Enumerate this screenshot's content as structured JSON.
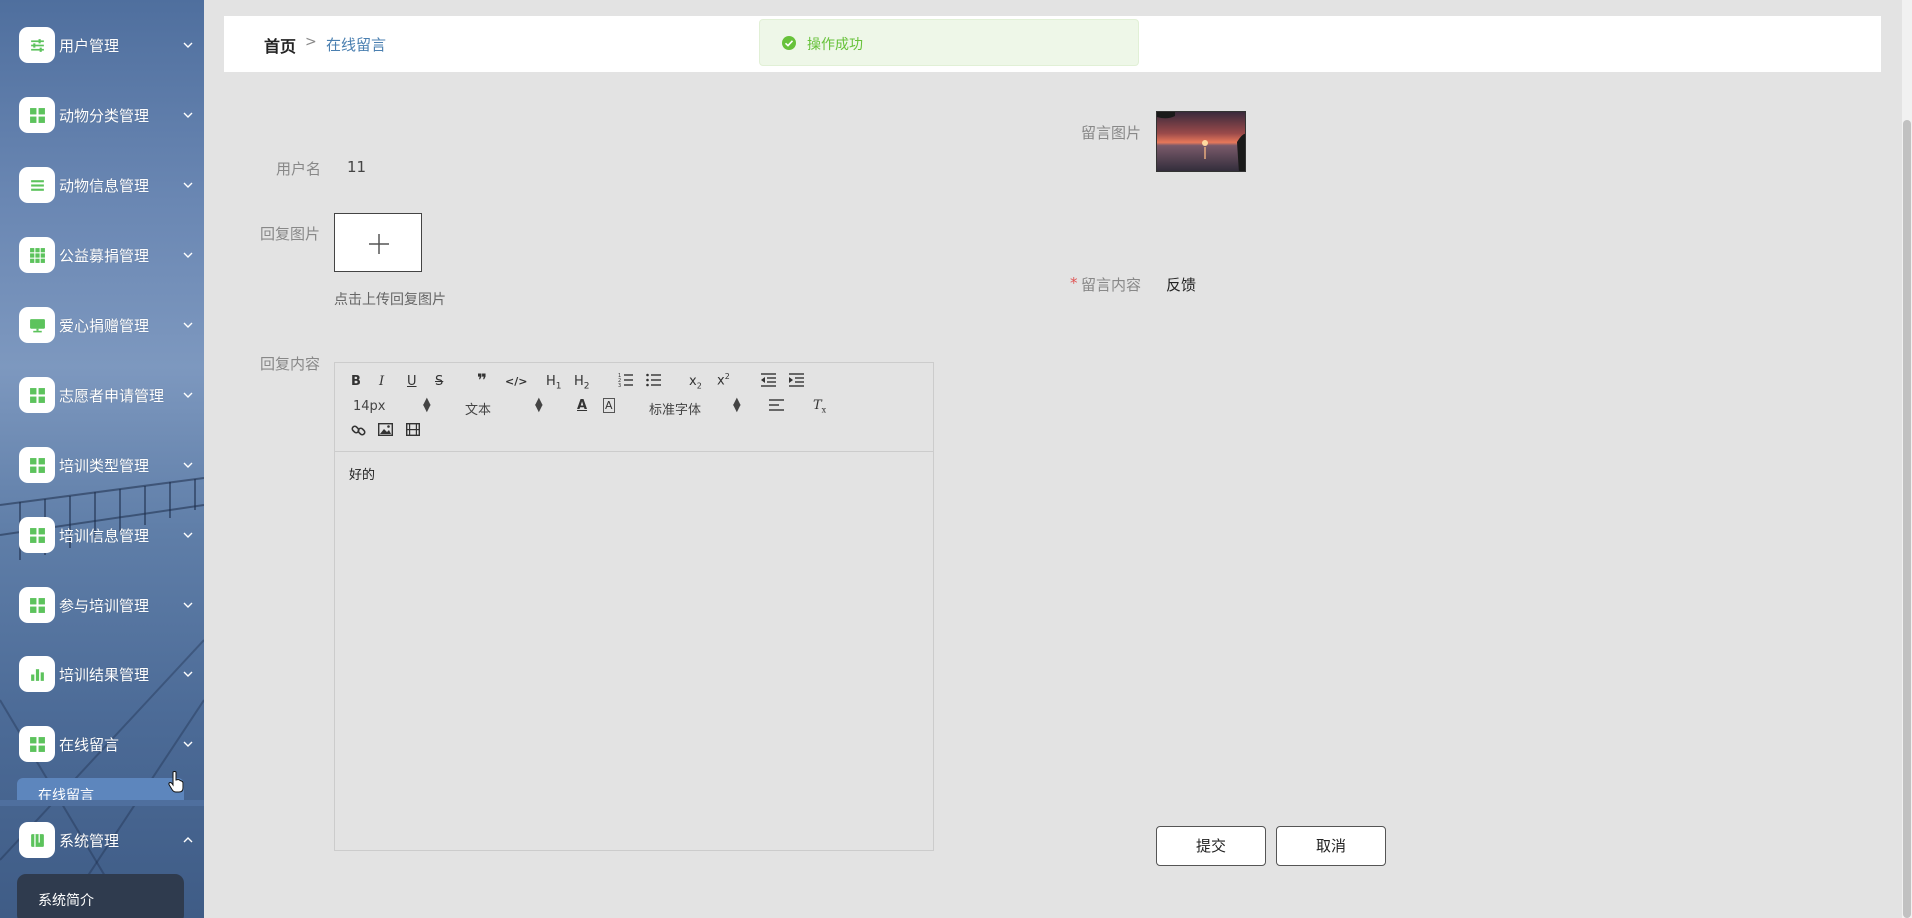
{
  "sidebar": {
    "items": [
      {
        "label": "用户管理",
        "icon": "sliders-icon",
        "expanded": false
      },
      {
        "label": "动物分类管理",
        "icon": "grid-icon",
        "expanded": false
      },
      {
        "label": "动物信息管理",
        "icon": "list-icon",
        "expanded": false
      },
      {
        "label": "公益募捐管理",
        "icon": "grid-nine-icon",
        "expanded": false
      },
      {
        "label": "爱心捐赠管理",
        "icon": "monitor-icon",
        "expanded": false
      },
      {
        "label": "志愿者申请管理",
        "icon": "grid-icon",
        "expanded": false
      },
      {
        "label": "培训类型管理",
        "icon": "grid-icon",
        "expanded": false
      },
      {
        "label": "培训信息管理",
        "icon": "grid-icon",
        "expanded": false
      },
      {
        "label": "参与培训管理",
        "icon": "grid-icon",
        "expanded": false
      },
      {
        "label": "培训结果管理",
        "icon": "bar-chart-icon",
        "expanded": false
      },
      {
        "label": "在线留言",
        "icon": "grid-icon",
        "expanded": true
      },
      {
        "label": "系统管理",
        "icon": "book-icon",
        "expanded": true
      }
    ],
    "online_message_sub": "在线留言",
    "system_sub": "系统简介"
  },
  "breadcrumb": {
    "home": "首页",
    "separator": ">",
    "current": "在线留言"
  },
  "toast": {
    "text": "操作成功",
    "color": "#67c23a"
  },
  "form": {
    "username_label": "用户名",
    "username_value": "11",
    "reply_image_label": "回复图片",
    "upload_hint": "点击上传回复图片",
    "reply_content_label": "回复内容",
    "message_image_label": "留言图片",
    "message_content_label": "留言内容",
    "message_content_required_mark": "*",
    "message_content_value": "反馈"
  },
  "editor": {
    "content": "好的",
    "font_size": "14px",
    "header_select": "文本",
    "font_family": "标准字体"
  },
  "buttons": {
    "submit": "提交",
    "cancel": "取消"
  }
}
